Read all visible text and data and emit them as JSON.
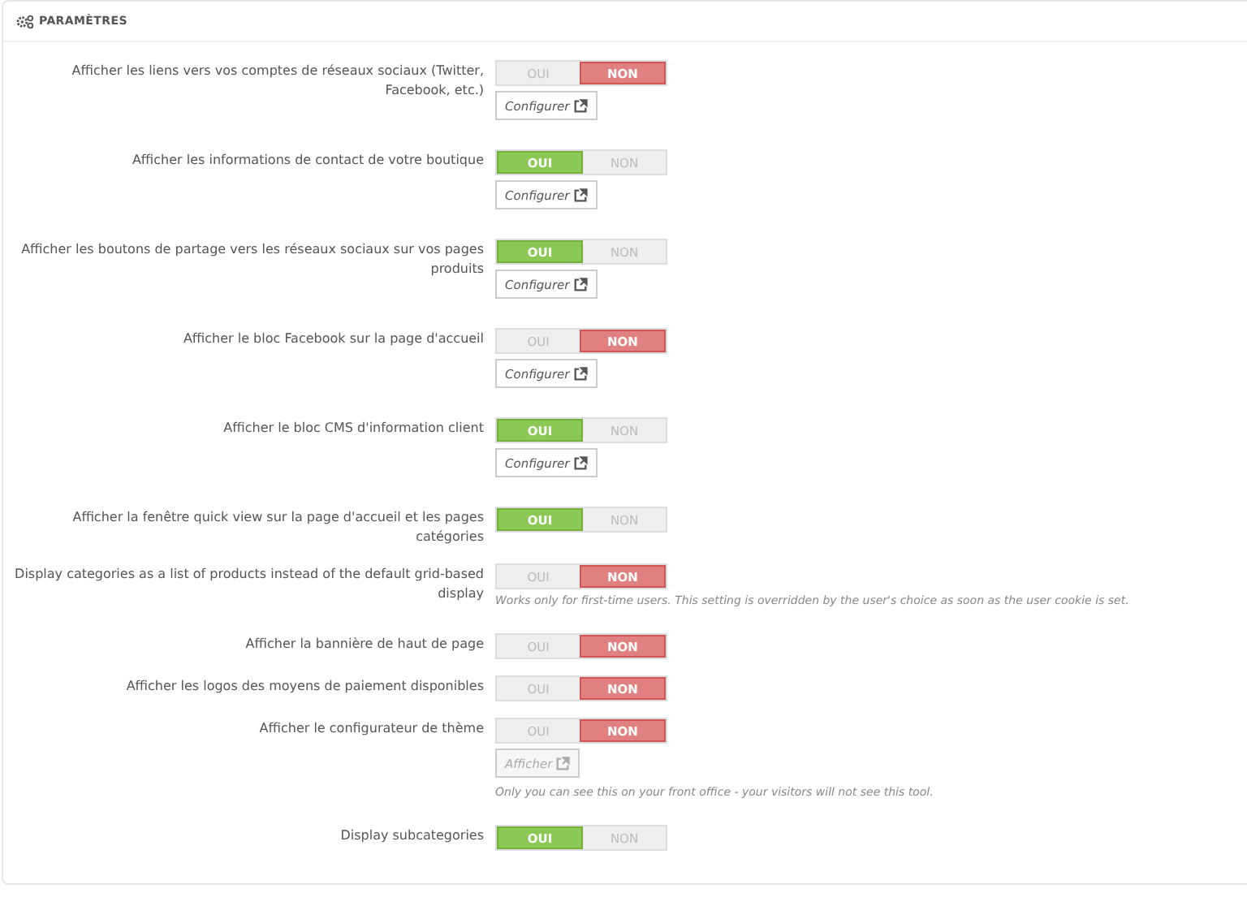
{
  "panel": {
    "title": "PARAMÈTRES"
  },
  "settings": [
    {
      "label": "Afficher les liens vers vos comptes de réseaux sociaux (Twitter, Facebook, etc.)",
      "options": [
        {
          "label": "OUI",
          "selected": false
        },
        {
          "label": "NON",
          "selected": true
        }
      ],
      "button": {
        "label": "Configurer",
        "disabled": false
      }
    },
    {
      "label": "Afficher les informations de contact de votre boutique",
      "options": [
        {
          "label": "OUI",
          "selected": true
        },
        {
          "label": "NON",
          "selected": false
        }
      ],
      "button": {
        "label": "Configurer",
        "disabled": false
      }
    },
    {
      "label": "Afficher les boutons de partage vers les réseaux sociaux sur vos pages produits",
      "options": [
        {
          "label": "OUI",
          "selected": true
        },
        {
          "label": "NON",
          "selected": false
        }
      ],
      "button": {
        "label": "Configurer",
        "disabled": false
      }
    },
    {
      "label": "Afficher le bloc Facebook sur la page d'accueil",
      "options": [
        {
          "label": "OUI",
          "selected": false
        },
        {
          "label": "NON",
          "selected": true
        }
      ],
      "button": {
        "label": "Configurer",
        "disabled": false
      }
    },
    {
      "label": "Afficher le bloc CMS d'information client",
      "options": [
        {
          "label": "OUI",
          "selected": true
        },
        {
          "label": "NON",
          "selected": false
        }
      ],
      "button": {
        "label": "Configurer",
        "disabled": false
      }
    },
    {
      "label": "Afficher la fenêtre quick view sur la page d'accueil et les pages catégories",
      "options": [
        {
          "label": "OUI",
          "selected": true
        },
        {
          "label": "NON",
          "selected": false
        }
      ]
    },
    {
      "label": "Display categories as a list of products instead of the default grid-based display",
      "options": [
        {
          "label": "OUI",
          "selected": false
        },
        {
          "label": "NON",
          "selected": true
        }
      ],
      "help": "Works only for first-time users. This setting is overridden by the user's choice as soon as the user cookie is set."
    },
    {
      "label": "Afficher la bannière de haut de page",
      "options": [
        {
          "label": "OUI",
          "selected": false
        },
        {
          "label": "NON",
          "selected": true
        }
      ]
    },
    {
      "label": "Afficher les logos des moyens de paiement disponibles",
      "options": [
        {
          "label": "OUI",
          "selected": false
        },
        {
          "label": "NON",
          "selected": true
        }
      ]
    },
    {
      "label": "Afficher le configurateur de thème",
      "options": [
        {
          "label": "OUI",
          "selected": false
        },
        {
          "label": "NON",
          "selected": true
        }
      ],
      "button": {
        "label": "Afficher",
        "disabled": true
      },
      "help": "Only you can see this on your front office - your visitors will not see this tool."
    },
    {
      "label": "Display subcategories",
      "options": [
        {
          "label": "OUI",
          "selected": true
        },
        {
          "label": "NON",
          "selected": false
        }
      ]
    }
  ]
}
